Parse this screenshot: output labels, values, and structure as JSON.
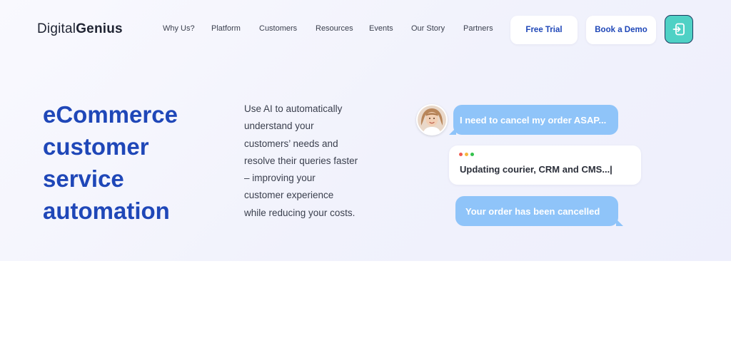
{
  "header": {
    "logo_part1": "Digital",
    "logo_part2": "Genius",
    "nav": [
      "Why Us?",
      "Platform",
      "Customers",
      "Resources",
      "Events",
      "Our Story",
      "Partners"
    ],
    "free_trial": "Free Trial",
    "book_demo": "Book a Demo",
    "login_icon": "login-icon"
  },
  "hero": {
    "title_lines": [
      "eCommerce",
      "customer",
      "service",
      "automation"
    ],
    "description_lines": [
      "Use AI to automatically",
      "understand your",
      "customers’ needs and",
      "resolve their queries faster",
      "– improving your",
      "customer experience",
      "while reducing your costs."
    ]
  },
  "chat": {
    "message_1": "I need to cancel my order ASAP...",
    "status": "Updating courier, CRM and CMS...|",
    "message_2": "Your order has been cancelled"
  },
  "colors": {
    "brand_blue": "#1f47b8",
    "bubble_blue": "#8fc4f9",
    "login_teal": "#4fd1c5",
    "dot_red": "#f05a4f",
    "dot_yellow": "#f6b73c",
    "dot_green": "#33c24d"
  }
}
